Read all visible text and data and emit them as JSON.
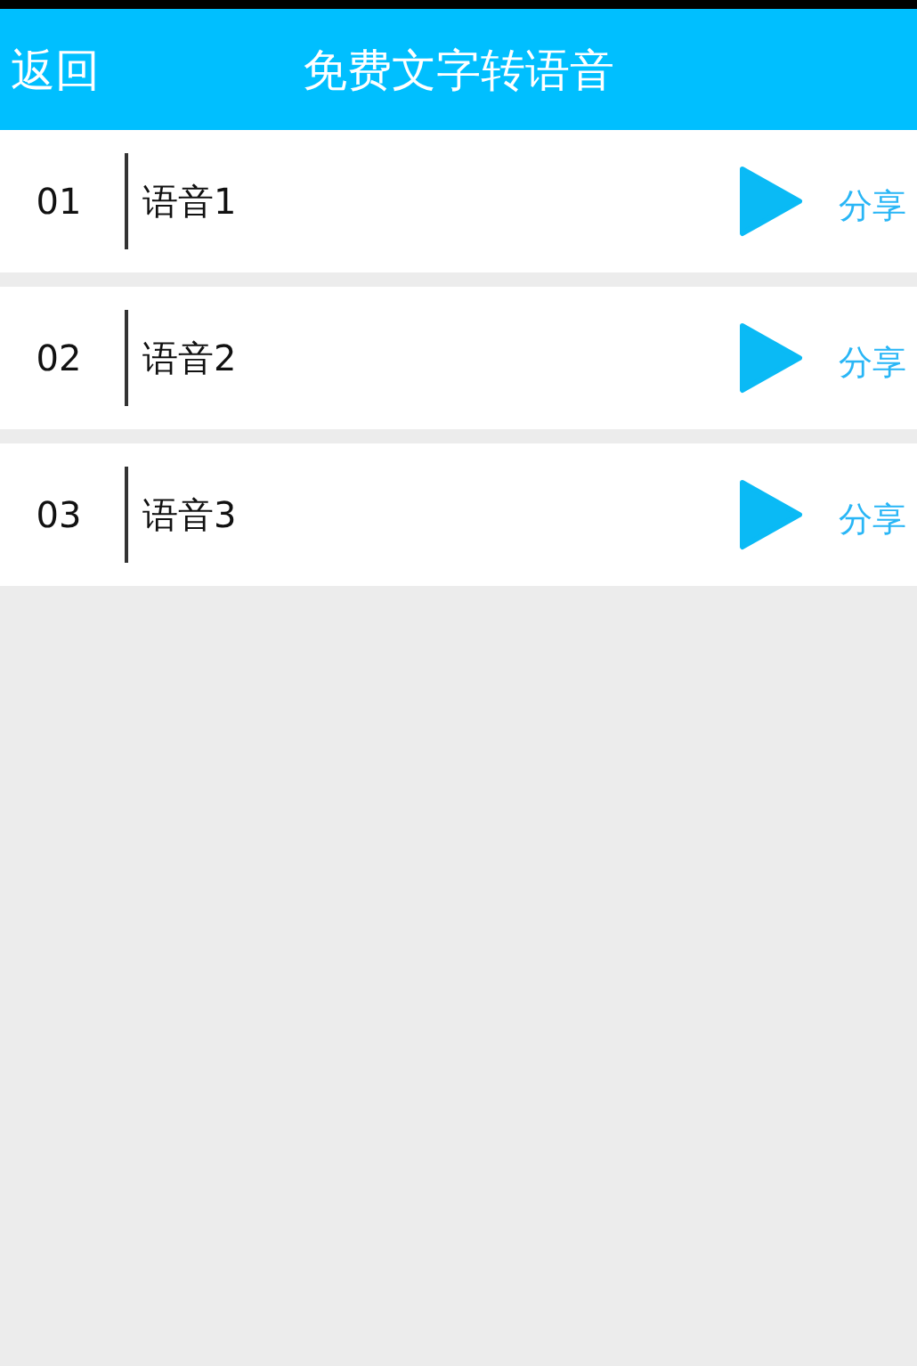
{
  "header": {
    "back": "返回",
    "title": "免费文字转语音"
  },
  "items": [
    {
      "number": "01",
      "name": "语音1",
      "share": "分享"
    },
    {
      "number": "02",
      "name": "语音2",
      "share": "分享"
    },
    {
      "number": "03",
      "name": "语音3",
      "share": "分享"
    }
  ]
}
